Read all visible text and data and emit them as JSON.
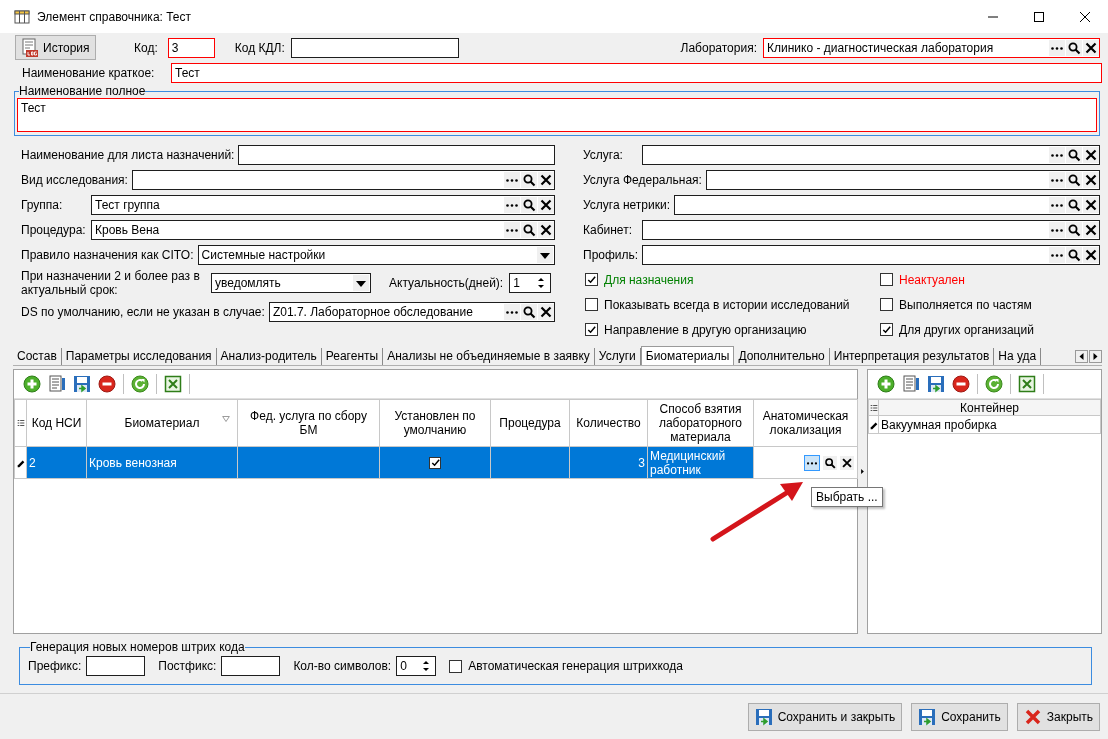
{
  "window": {
    "title": "Элемент справочника: Тест"
  },
  "header": {
    "history_button": "История",
    "code": {
      "label": "Код:",
      "value": "3",
      "required": true
    },
    "kdl_code": {
      "label": "Код КДЛ:",
      "required": false
    },
    "laboratory": {
      "label": "Лаборатория:",
      "value": "Клинико - диагностическая лаборатория",
      "required": true
    }
  },
  "short_name": {
    "label": "Наименование краткое:",
    "value": "Тест",
    "required": true
  },
  "full_name": {
    "label": "Наименование полное",
    "value": "Тест",
    "required": true
  },
  "left_fields": [
    {
      "kind": "text",
      "label": "Наименование для листа назначений:"
    },
    {
      "kind": "lookup",
      "label": "Вид исследования:"
    },
    {
      "kind": "lookup",
      "label": "Группа:",
      "value": "Тест группа"
    },
    {
      "kind": "lookup",
      "label": "Процедура:",
      "value": "Кровь Вена"
    },
    {
      "kind": "combo",
      "label": "Правило назначения как CITO:",
      "value": "Системные настройки"
    },
    {
      "kind": "combo_spin",
      "label": "При назначении 2 и более раз в актуальный срок:",
      "value": "уведомлять",
      "spin_label": "Актуальность(дней):",
      "spin_value": "1"
    },
    {
      "kind": "lookup",
      "label": "DS по умолчанию, если не указан в случае:",
      "value": "Z01.7. Лабораторное обследование"
    }
  ],
  "right_fields": [
    {
      "kind": "lookup",
      "label": "Услуга:"
    },
    {
      "kind": "lookup",
      "label": "Услуга Федеральная:"
    },
    {
      "kind": "lookup",
      "label": "Услуга нетрики:"
    },
    {
      "kind": "lookup",
      "label": "Кабинет:"
    },
    {
      "kind": "lookup",
      "label": "Профиль:"
    }
  ],
  "checkboxes": [
    {
      "label": "Для назначения",
      "checked": true,
      "color": "#008000"
    },
    {
      "label": "Неактуален",
      "checked": false,
      "color": "#ff0000"
    },
    {
      "label": "Показывать всегда в истории исследований",
      "checked": false
    },
    {
      "label": "Выполняется по частям",
      "checked": false
    },
    {
      "label": "Направление в другую организацию",
      "checked": true
    },
    {
      "label": "Для других организаций",
      "checked": true
    }
  ],
  "tabs": [
    {
      "label": "Состав",
      "selected": false
    },
    {
      "label": "Параметры исследования",
      "selected": false
    },
    {
      "label": "Анализ-родитель",
      "selected": false
    },
    {
      "label": "Реагенты",
      "selected": false
    },
    {
      "label": "Анализы не объединяемые в заявку",
      "selected": false
    },
    {
      "label": "Услуги",
      "selected": false
    },
    {
      "label": "Биоматериалы",
      "selected": true
    },
    {
      "label": "Дополнительно",
      "selected": false
    },
    {
      "label": "Интерпретация результатов",
      "selected": false
    },
    {
      "label": "На уда",
      "selected": false
    }
  ],
  "grid": {
    "columns": [
      "Код НСИ",
      "Биоматериал",
      "Фед. услуга по сбору БМ",
      "Установлен по умолчанию",
      "Процедура",
      "Количество",
      "Способ взятия лабораторного материала",
      "Анатомическая локализация"
    ],
    "rows": [
      {
        "selected": true,
        "cells": [
          {
            "kind": "text",
            "value": "2"
          },
          {
            "kind": "text",
            "value": "Кровь венозная"
          },
          {
            "kind": "empty"
          },
          {
            "kind": "check",
            "checked": true
          },
          {
            "kind": "empty"
          },
          {
            "kind": "number",
            "value": "3"
          },
          {
            "kind": "text",
            "value": "Медицинский работник"
          },
          {
            "kind": "editor",
            "tooltip": "Выбрать ..."
          }
        ]
      }
    ]
  },
  "container_grid": {
    "columns": [
      "Контейнер"
    ],
    "rows": [
      "Вакуумная пробирка"
    ]
  },
  "barcode": {
    "title": "Генерация новых номеров штрих кода",
    "prefix_label": "Префикс:",
    "postfix_label": "Постфикс:",
    "count_label": "Кол-во символов:",
    "count_value": "0",
    "auto": {
      "label": "Автоматическая генерация штрихкода",
      "checked": false
    }
  },
  "buttons": [
    {
      "kind": "save",
      "label": "Сохранить и закрыть"
    },
    {
      "kind": "save",
      "label": "Сохранить"
    },
    {
      "kind": "close",
      "label": "Закрыть"
    }
  ]
}
